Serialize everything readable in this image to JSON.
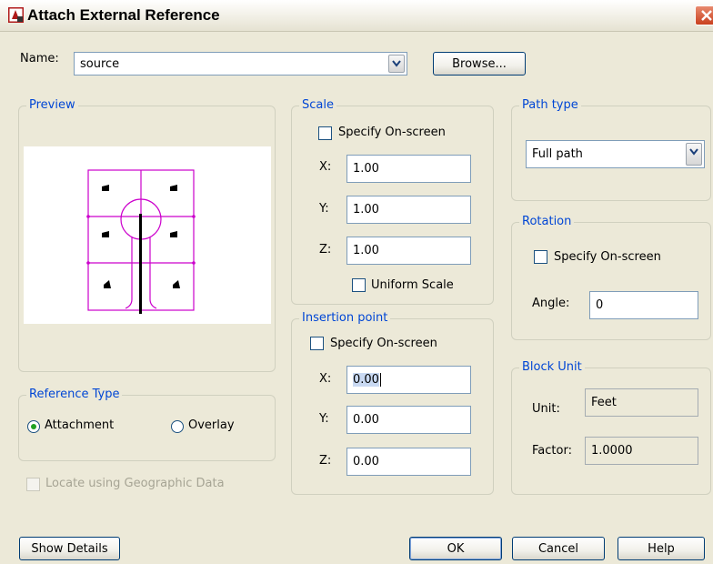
{
  "window": {
    "title": "Attach External Reference"
  },
  "name_field": {
    "label": "Name:",
    "value": "source"
  },
  "buttons": {
    "browse": "Browse...",
    "show_details": "Show Details",
    "ok": "OK",
    "cancel": "Cancel",
    "help": "Help"
  },
  "preview": {
    "title": "Preview"
  },
  "reference_type": {
    "title": "Reference Type",
    "attachment": "Attachment",
    "overlay": "Overlay",
    "selected": "Attachment"
  },
  "geo": {
    "label": "Locate using Geographic Data"
  },
  "scale": {
    "title": "Scale",
    "specify_label": "Specify On-screen",
    "x_label": "X:",
    "x_value": "1.00",
    "y_label": "Y:",
    "y_value": "1.00",
    "z_label": "Z:",
    "z_value": "1.00",
    "uniform_label": "Uniform Scale"
  },
  "insertion": {
    "title": "Insertion point",
    "specify_label": "Specify On-screen",
    "x_label": "X:",
    "x_value": "0.00",
    "y_label": "Y:",
    "y_value": "0.00",
    "z_label": "Z:",
    "z_value": "0.00"
  },
  "path_type": {
    "title": "Path type",
    "value": "Full path"
  },
  "rotation": {
    "title": "Rotation",
    "specify_label": "Specify On-screen",
    "angle_label": "Angle:",
    "angle_value": "0"
  },
  "block_unit": {
    "title": "Block Unit",
    "unit_label": "Unit:",
    "unit_value": "Feet",
    "factor_label": "Factor:",
    "factor_value": "1.0000"
  },
  "colors": {
    "group_title": "#0046d5",
    "preview_lines": "#cc00cc",
    "dialog_bg": "#ece9d8",
    "close_button": "#c9401f"
  }
}
